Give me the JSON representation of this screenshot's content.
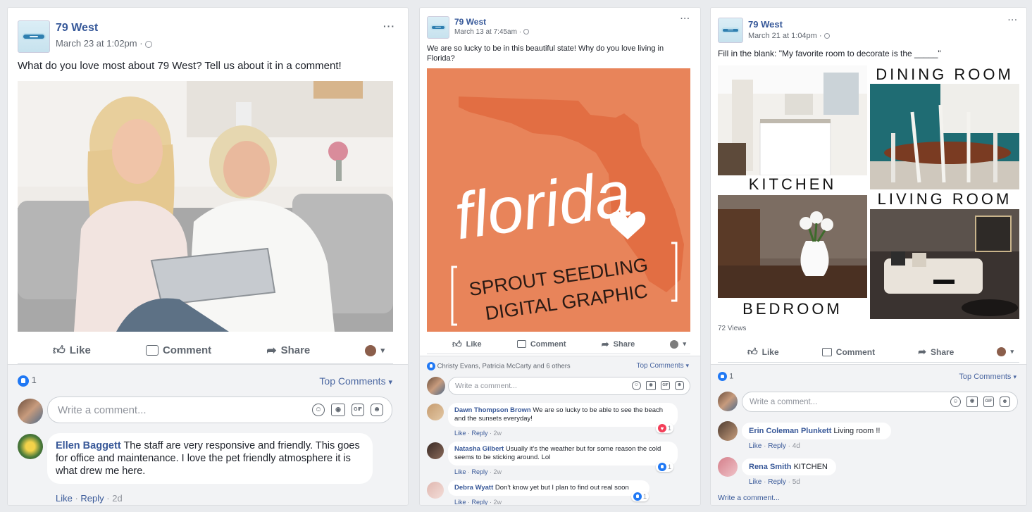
{
  "posts": [
    {
      "page_name": "79 West",
      "timestamp": "March 23 at 1:02pm",
      "text": "What do you love most about 79 West? Tell us about it in a comment!",
      "actions": {
        "like": "Like",
        "comment": "Comment",
        "share": "Share"
      },
      "reaction_count": "1",
      "top_comments": "Top Comments",
      "comment_placeholder": "Write a comment...",
      "comments": [
        {
          "author": "Ellen Baggett",
          "text": "The staff are very responsive and friendly. This goes for office and maintenance. I love the pet friendly atmosphere it is what drew me here.",
          "like": "Like",
          "reply": "Reply",
          "age": "2d"
        }
      ]
    },
    {
      "page_name": "79 West",
      "timestamp": "March 13 at 7:45am",
      "text": "We are so lucky to be in this beautiful state! Why do you love living in Florida?",
      "graphic": {
        "script_word": "florida",
        "caption_line1": "SPROUT SEEDLING",
        "caption_line2": "DIGITAL GRAPHIC",
        "bg_color": "#e8845a"
      },
      "actions": {
        "like": "Like",
        "comment": "Comment",
        "share": "Share"
      },
      "reactors": "Christy Evans, Patricia McCarty and 6 others",
      "top_comments": "Top Comments",
      "comment_placeholder": "Write a comment...",
      "comments": [
        {
          "author": "Dawn Thompson Brown",
          "text": "We are so lucky to be able to see the beach and the sunsets everyday!",
          "like": "Like",
          "reply": "Reply",
          "age": "2w",
          "reactions": "1"
        },
        {
          "author": "Natasha Gilbert",
          "text": "Usually it's the weather but for some reason the cold seems to be sticking around. Lol",
          "like": "Like",
          "reply": "Reply",
          "age": "2w",
          "reactions": "1"
        },
        {
          "author": "Debra Wyatt",
          "text": "Don't know yet but I plan to find out real soon",
          "like": "Like",
          "reply": "Reply",
          "age": "2w",
          "reactions": "1"
        }
      ]
    },
    {
      "page_name": "79 West",
      "timestamp": "March 21 at 1:04pm",
      "text": "Fill in the blank: \"My favorite room to decorate is the _____\"",
      "collage": {
        "kitchen": "KITCHEN",
        "dining": "DINING ROOM",
        "living": "LIVING ROOM",
        "bedroom": "BEDROOM"
      },
      "views": "72 Views",
      "actions": {
        "like": "Like",
        "comment": "Comment",
        "share": "Share"
      },
      "reaction_count": "1",
      "top_comments": "Top Comments",
      "comment_placeholder": "Write a comment...",
      "comments": [
        {
          "author": "Erin Coleman Plunkett",
          "text": "Living room !!",
          "like": "Like",
          "reply": "Reply",
          "age": "4d"
        },
        {
          "author": "Rena Smith",
          "text": "KITCHEN",
          "like": "Like",
          "reply": "Reply",
          "age": "5d"
        }
      ],
      "write_comment_link": "Write a comment..."
    }
  ],
  "dropdown_caret": "▾",
  "separator": " · ",
  "colors": {
    "link_blue": "#365899",
    "fb_blue": "#2078f4",
    "florida_orange": "#e8845a",
    "page_bg": "#e9ebee"
  }
}
